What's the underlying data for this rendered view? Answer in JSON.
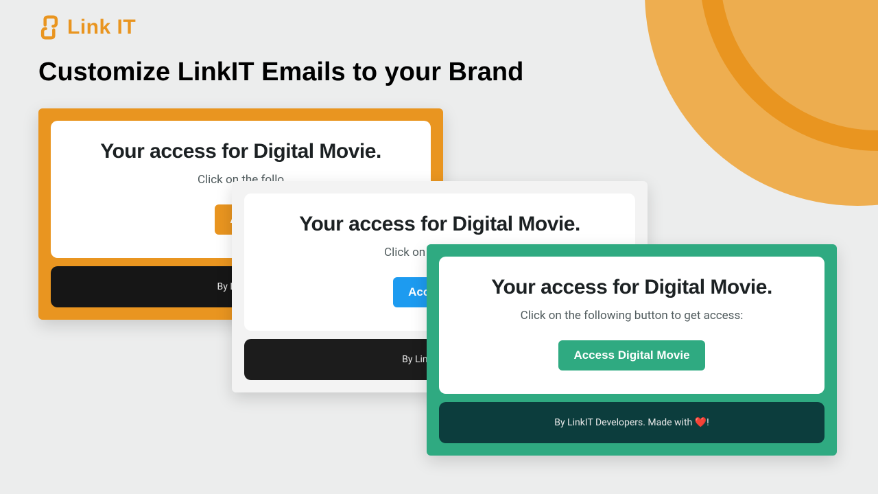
{
  "brand": {
    "name": "Link IT",
    "accent": "#e99520"
  },
  "page": {
    "title": "Customize LinkIT Emails to your Brand"
  },
  "email_card": {
    "heading": "Your access for Digital Movie.",
    "subtext_full": "Click on the following button to get access:",
    "subtext_partial_a": "Click on the follo",
    "subtext_partial_b": "Click on the following",
    "button_full": "Access Digital Movie",
    "button_partial_a": "Acc",
    "button_partial_b": "Access Dig",
    "footer_full": "By LinkIT Developers. Made with ❤️!",
    "footer_partial_a": "By LinkIT D",
    "footer_partial_b": "By LinkIT Develop"
  },
  "colors": {
    "card1_bg": "#e99520",
    "card1_btn": "#e99520",
    "card2_bg": "#f3f3f3",
    "card2_btn": "#1d9bf0",
    "card3_bg": "#2faa81",
    "card3_btn": "#2faa81"
  }
}
